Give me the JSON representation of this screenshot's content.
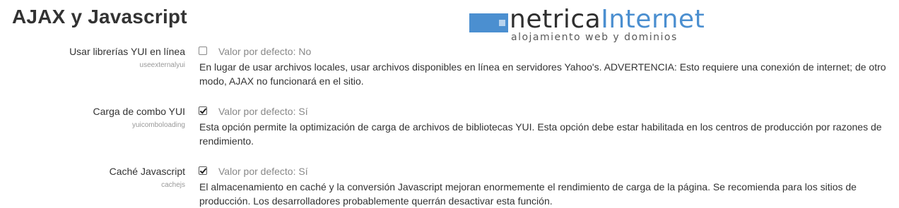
{
  "page": {
    "title": "AJAX y Javascript"
  },
  "logo": {
    "text_dark": "netrica",
    "text_blue": "Internet",
    "tagline": "alojamiento web y dominios",
    "colors": {
      "blue": "#4b8fd0",
      "dark": "#2f2f2f"
    }
  },
  "settings": [
    {
      "label": "Usar librerías YUI en línea",
      "key": "useexternalyui",
      "checked": false,
      "default": "Valor por defecto: No",
      "description": "En lugar de usar archivos locales, usar archivos disponibles en línea en servidores Yahoo's. ADVERTENCIA: Esto requiere una conexión de internet; de otro modo, AJAX no funcionará en el sitio."
    },
    {
      "label": "Carga de combo YUI",
      "key": "yuicomboloading",
      "checked": true,
      "default": "Valor por defecto: Sí",
      "description": "Esta opción permite la optimización de carga de archivos de bibliotecas YUI. Esta opción debe estar habilitada en los centros de producción por razones de rendimiento."
    },
    {
      "label": "Caché Javascript",
      "key": "cachejs",
      "checked": true,
      "default": "Valor por defecto: Sí",
      "description": "El almacenamiento en caché y la conversión Javascript mejoran enormemente el rendimiento de carga de la página. Se recomienda para los sitios de producción. Los desarrolladores probablemente querrán desactivar esta función."
    }
  ]
}
